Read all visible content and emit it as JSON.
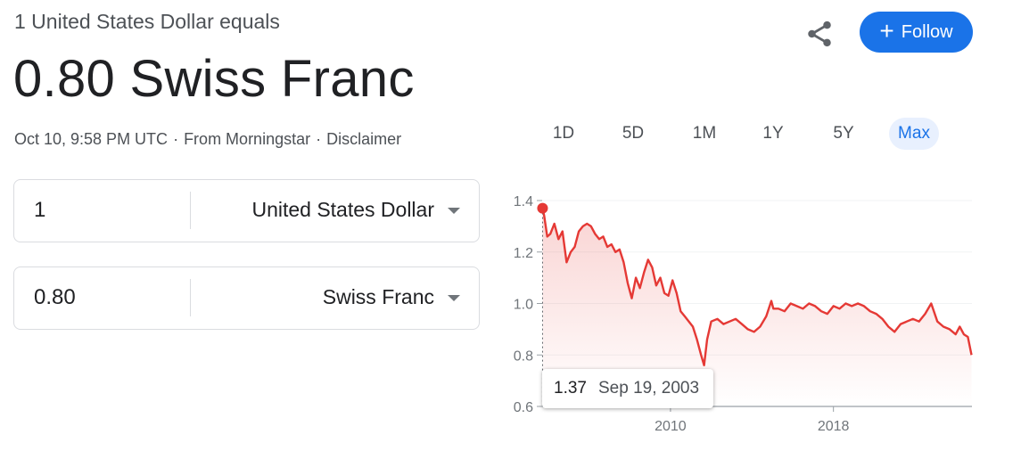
{
  "header": {
    "subtitle": "1 United States Dollar equals",
    "rate": "0.80 Swiss Franc",
    "timestamp": "Oct 10, 9:58 PM UTC",
    "source": "From Morningstar",
    "disclaimer": "Disclaimer",
    "sep": "·"
  },
  "actions": {
    "follow_label": "Follow",
    "share_icon": "share-icon"
  },
  "ranges": [
    "1D",
    "5D",
    "1M",
    "1Y",
    "5Y",
    "Max"
  ],
  "active_range": "Max",
  "converter": {
    "from": {
      "value": "1",
      "currency": "United States Dollar"
    },
    "to": {
      "value": "0.80",
      "currency": "Swiss Franc"
    }
  },
  "tooltip": {
    "value": "1.37",
    "date": "Sep 19, 2003"
  },
  "colors": {
    "line": "#e53935",
    "accent": "#1a73e8",
    "active_bg": "#e8f0fe"
  },
  "chart_data": {
    "type": "area",
    "ylim": [
      0.6,
      1.4
    ],
    "yticks": [
      "0.6",
      "0.8",
      "1.0",
      "1.2",
      "1.4"
    ],
    "xticks": [
      "2010",
      "2018"
    ],
    "xlim": [
      2003.7,
      2024.8
    ],
    "grid": true,
    "series": [
      {
        "x": [
          2003.72,
          2003.8,
          2003.95,
          2004.1,
          2004.3,
          2004.5,
          2004.7,
          2004.9,
          2005.1,
          2005.3,
          2005.5,
          2005.7,
          2005.9,
          2006.1,
          2006.3,
          2006.5,
          2006.7,
          2006.9,
          2007.1,
          2007.3,
          2007.5,
          2007.7,
          2007.9,
          2008.1,
          2008.3,
          2008.5,
          2008.7,
          2008.9,
          2009.1,
          2009.3,
          2009.5,
          2009.7,
          2009.9,
          2010.1,
          2010.3,
          2010.5,
          2010.7,
          2010.9,
          2011.1,
          2011.3,
          2011.5,
          2011.65,
          2011.8,
          2012.0,
          2012.3,
          2012.6,
          2012.9,
          2013.2,
          2013.5,
          2013.8,
          2014.1,
          2014.4,
          2014.7,
          2014.95,
          2015.05,
          2015.3,
          2015.6,
          2015.9,
          2016.2,
          2016.5,
          2016.8,
          2017.1,
          2017.4,
          2017.7,
          2018.0,
          2018.3,
          2018.6,
          2018.9,
          2019.2,
          2019.5,
          2019.8,
          2020.1,
          2020.4,
          2020.7,
          2021.0,
          2021.3,
          2021.6,
          2021.9,
          2022.2,
          2022.5,
          2022.8,
          2023.1,
          2023.4,
          2023.7,
          2024.0,
          2024.2,
          2024.4,
          2024.6,
          2024.78
        ],
        "y": [
          1.37,
          1.34,
          1.26,
          1.27,
          1.31,
          1.25,
          1.28,
          1.16,
          1.2,
          1.22,
          1.28,
          1.3,
          1.31,
          1.3,
          1.27,
          1.25,
          1.26,
          1.22,
          1.23,
          1.2,
          1.21,
          1.16,
          1.08,
          1.02,
          1.1,
          1.06,
          1.12,
          1.17,
          1.14,
          1.07,
          1.1,
          1.04,
          1.03,
          1.09,
          1.04,
          0.97,
          0.95,
          0.93,
          0.91,
          0.86,
          0.8,
          0.76,
          0.86,
          0.93,
          0.94,
          0.92,
          0.93,
          0.94,
          0.92,
          0.9,
          0.89,
          0.91,
          0.95,
          1.01,
          0.98,
          0.98,
          0.97,
          1.0,
          0.99,
          0.98,
          1.0,
          0.99,
          0.97,
          0.96,
          0.99,
          0.98,
          1.0,
          0.99,
          1.0,
          0.99,
          0.97,
          0.96,
          0.94,
          0.91,
          0.89,
          0.92,
          0.93,
          0.94,
          0.93,
          0.96,
          1.0,
          0.93,
          0.91,
          0.9,
          0.88,
          0.91,
          0.88,
          0.87,
          0.8
        ]
      }
    ],
    "marker": {
      "x": 2003.72,
      "y": 1.37
    }
  }
}
